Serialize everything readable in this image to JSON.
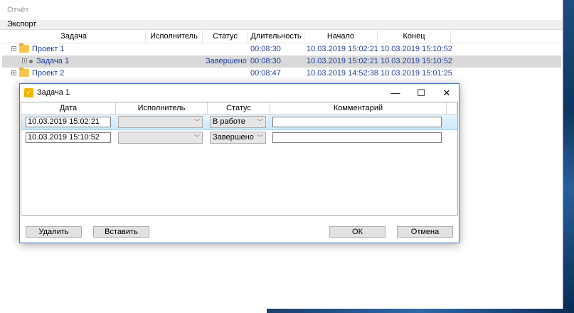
{
  "window": {
    "title": "Отчёт"
  },
  "menu": {
    "export": "Экспорт"
  },
  "tree": {
    "columns": [
      "Задача",
      "Исполнитель",
      "Статус",
      "Длительность",
      "Начало",
      "Конец"
    ],
    "rows": [
      {
        "expander": "⊟",
        "name": "Проект 1",
        "assignee": "",
        "status": "",
        "duration": "00:08:30",
        "start": "10.03.2019 15:02:21",
        "end": "10.03.2019 15:10:52"
      },
      {
        "expander": "⊞",
        "name": "Задача 1",
        "assignee": "",
        "status": "Завершено",
        "duration": "00:08:30",
        "start": "10.03.2019 15:02:21",
        "end": "10.03.2019 15:10:52"
      },
      {
        "expander": "⊞",
        "name": "Проект 2",
        "assignee": "",
        "status": "",
        "duration": "00:08:47",
        "start": "10.03.2019 14:52:38",
        "end": "10.03.2019 15:01:25"
      }
    ]
  },
  "dialog": {
    "title": "Задача 1",
    "icon": "✓",
    "window_buttons": {
      "minimize": "—",
      "maximize": "☐",
      "close": "✕"
    },
    "columns": [
      "Дата",
      "Исполнитель",
      "Статус",
      "Комментарий"
    ],
    "rows": [
      {
        "date": "10.03.2019 15:02:21",
        "assignee": "",
        "status": "В работе",
        "comment": ""
      },
      {
        "date": "10.03.2019 15:10:52",
        "assignee": "",
        "status": "Завершено",
        "comment": ""
      }
    ],
    "buttons": {
      "delete": "Удалить",
      "insert": "Вставить",
      "ok": "ОК",
      "cancel": "Отмена"
    }
  },
  "icons": {
    "combo_arrow": "﹀",
    "folder": "folder-icon"
  },
  "colors": {
    "accent": "#3a78c6",
    "folder": "#f9c84a",
    "tree_text": "#1f3fa0",
    "selected_row": "#cde8fb"
  }
}
